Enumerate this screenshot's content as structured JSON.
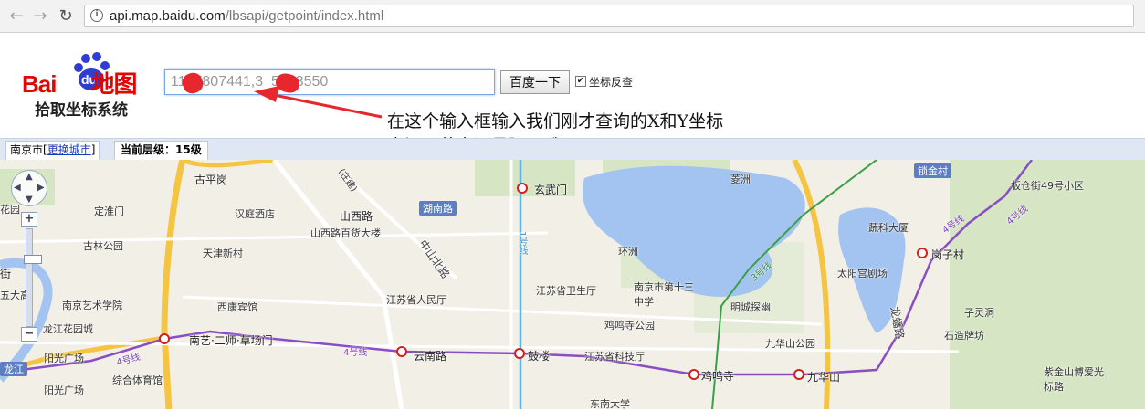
{
  "browser": {
    "url_host": "api.map.baidu.com",
    "url_path": "/lbsapi/getpoint/index.html"
  },
  "header": {
    "logo_text": "Bai du 地图",
    "logo_sub": "拾取坐标系统",
    "search_value": "11  7807441,3  5723550",
    "search_button": "百度一下",
    "checkbox_label": "坐标反查",
    "checkbox_checked": true
  },
  "annotation": {
    "line1": "在这个输入框输入我们刚才查询的X和Y坐标",
    "line2": "中间用英文逗号隔开哦!"
  },
  "infobar": {
    "city": "南京市",
    "change_city": "更换城市",
    "level": "当前层级：15级"
  },
  "map": {
    "labels": {
      "guping": "古平岗",
      "dinghuaimen": "定淮门",
      "huayuan": "花园",
      "hanting": "汉庭酒店",
      "shanxilu": "山西路",
      "shanxibaihuo": "山西路百货大楼",
      "gulin": "古林公园",
      "tianjin": "天津新村",
      "jie": "街",
      "wuda": "五大高",
      "nanyi_art": "南京艺术学院",
      "xikang": "西康宾馆",
      "longjiang": "龙江花园城",
      "yangguang1": "阳光广场",
      "yangguang2": "阳光广场",
      "longjiang2": "龙江",
      "zonghe": "综合体育馆",
      "nanyi_stn": "南艺·二师·草场门",
      "yunnanlu": "云南路",
      "gulou": "鼓楼",
      "jiangsu_people": "江苏省人民厅",
      "jiangsu_health": "江苏省卫生厅",
      "xuanwumen": "玄武门",
      "hunanlu": "湖南路",
      "zhongshanbeilu": "中山北路",
      "yizhou": "菱洲",
      "huanzhou": "环洲",
      "nj13": "南京市第十三中学",
      "jimingsi_park": "鸡鸣寺公园",
      "jiangsu_tech": "江苏省科技厅",
      "dongnan": "东南大学",
      "jimingsi_stn": "鸡鸣寺",
      "mingcheng": "明城探幽",
      "jiuhuashan_park": "九华山公园",
      "jiuhuashan_stn": "九华山",
      "suojin": "锁金村",
      "bancang": "板仓街49号小区",
      "shuke": "蔬科大厦",
      "gangzicun": "岗子村",
      "taiyanggong": "太阳宫剧场",
      "zilingdong": "子灵洞",
      "shizao": "石造牌坊",
      "longpanlu": "龙蟠路",
      "zijinshan": "紫金山博爱光标路",
      "line4_a": "4号线",
      "line4_b": "4号线",
      "line4_c": "4号线",
      "line1": "1号线",
      "line3": "3号线",
      "line4_d": "4号线",
      "zaijian": "(在建)"
    }
  },
  "colors": {
    "logo_red": "#e10601",
    "water": "#a3c4f0",
    "metro_purple": "#8a4ec4",
    "road_yellow": "#f5c442"
  }
}
